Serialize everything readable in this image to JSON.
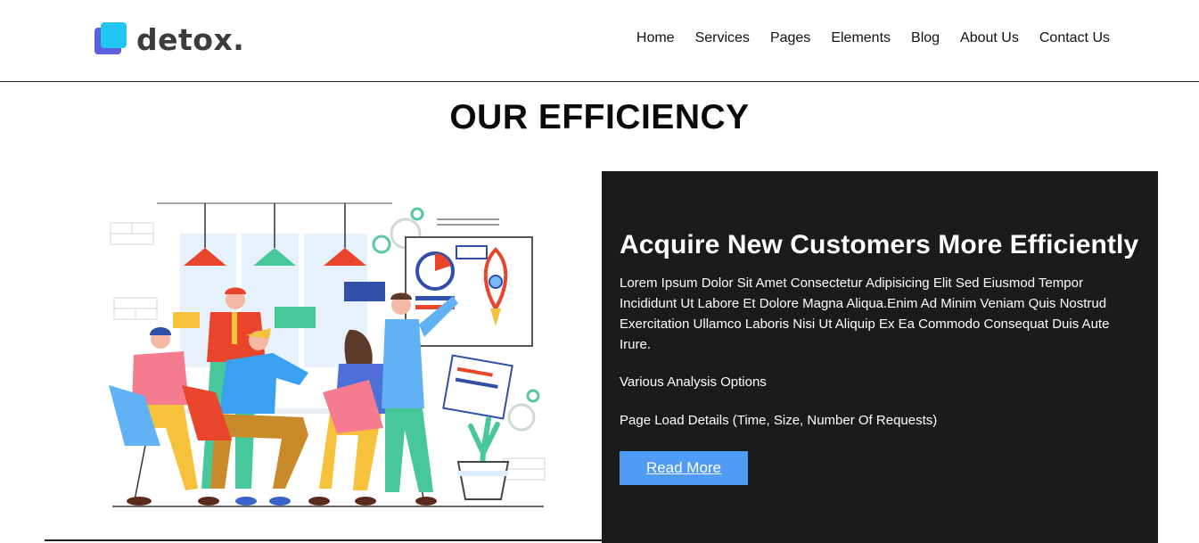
{
  "brand": {
    "name": "detox.",
    "colors": {
      "logo_front": "#21c6f2",
      "logo_back": "#5b5fe0"
    }
  },
  "nav": {
    "items": [
      "Home",
      "Services",
      "Pages",
      "Elements",
      "Blog",
      "About Us",
      "Contact Us"
    ]
  },
  "section": {
    "title": "OUR EFFICIENCY"
  },
  "panel": {
    "heading": "Acquire New Customers More Efficiently",
    "description": "Lorem Ipsum Dolor Sit Amet Consectetur Adipisicing Elit Sed Eiusmod Tempor Incididunt Ut Labore Et Dolore Magna Aliqua.Enim Ad Minim Veniam Quis Nostrud Exercitation Ullamco Laboris Nisi Ut Aliquip Ex Ea Commodo Consequat Duis Aute Irure.",
    "features": [
      "Various Analysis Options",
      "Page Load Details (Time, Size, Number Of Requests)"
    ],
    "button_label": "Read More",
    "colors": {
      "background": "#1b1a1c",
      "button": "#4f9bf5"
    }
  }
}
